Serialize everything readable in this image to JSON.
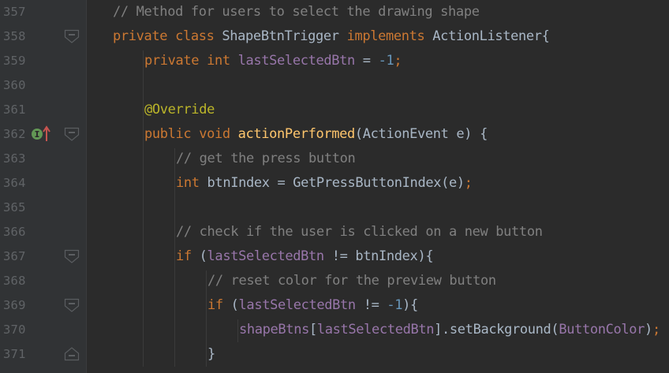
{
  "editor": {
    "lines": [
      {
        "number": "357",
        "indent": 0,
        "tokens": [
          [
            "c-comment",
            "// Method for users to select the drawing shape"
          ]
        ]
      },
      {
        "number": "358",
        "indent": 0,
        "fold": "open",
        "tokens": [
          [
            "c-kw",
            "private class "
          ],
          [
            "c-plain",
            "ShapeBtnTrigger "
          ],
          [
            "c-kw",
            "implements "
          ],
          [
            "c-plain",
            "ActionListener{"
          ]
        ]
      },
      {
        "number": "359",
        "indent": 1,
        "tokens": [
          [
            "c-kw",
            "private int "
          ],
          [
            "c-field",
            "lastSelectedBtn"
          ],
          [
            "c-plain",
            " = "
          ],
          [
            "c-num",
            "-1"
          ],
          [
            "c-kw",
            ";"
          ]
        ]
      },
      {
        "number": "360",
        "indent": 1,
        "tokens": []
      },
      {
        "number": "361",
        "indent": 1,
        "tokens": [
          [
            "c-ann",
            "@Override"
          ]
        ]
      },
      {
        "number": "362",
        "indent": 1,
        "fold": "open",
        "marker": "implements-method",
        "tokens": [
          [
            "c-kw",
            "public void "
          ],
          [
            "c-method",
            "actionPerformed"
          ],
          [
            "c-plain",
            "(ActionEvent e) {"
          ]
        ]
      },
      {
        "number": "363",
        "indent": 2,
        "tokens": [
          [
            "c-comment",
            "// get the press button"
          ]
        ]
      },
      {
        "number": "364",
        "indent": 2,
        "tokens": [
          [
            "c-kw",
            "int "
          ],
          [
            "c-plain",
            "btnIndex = GetPressButtonIndex(e)"
          ],
          [
            "c-kw",
            ";"
          ]
        ]
      },
      {
        "number": "365",
        "indent": 2,
        "tokens": []
      },
      {
        "number": "366",
        "indent": 2,
        "tokens": [
          [
            "c-comment",
            "// check if the user is clicked on a new button"
          ]
        ]
      },
      {
        "number": "367",
        "indent": 2,
        "fold": "open",
        "tokens": [
          [
            "c-kw",
            "if "
          ],
          [
            "c-plain",
            "("
          ],
          [
            "c-field",
            "lastSelectedBtn"
          ],
          [
            "c-plain",
            " != btnIndex){"
          ]
        ]
      },
      {
        "number": "368",
        "indent": 3,
        "tokens": [
          [
            "c-comment",
            "// reset color for the preview button"
          ]
        ]
      },
      {
        "number": "369",
        "indent": 3,
        "fold": "open",
        "tokens": [
          [
            "c-kw",
            "if "
          ],
          [
            "c-plain",
            "("
          ],
          [
            "c-field",
            "lastSelectedBtn"
          ],
          [
            "c-plain",
            " != "
          ],
          [
            "c-num",
            "-1"
          ],
          [
            "c-plain",
            "){"
          ]
        ]
      },
      {
        "number": "370",
        "indent": 4,
        "tokens": [
          [
            "c-field",
            "shapeBtns"
          ],
          [
            "c-plain",
            "["
          ],
          [
            "c-field",
            "lastSelectedBtn"
          ],
          [
            "c-plain",
            "].setBackground("
          ],
          [
            "c-field",
            "ButtonColor"
          ],
          [
            "c-plain",
            ")"
          ],
          [
            "c-kw",
            ";"
          ]
        ]
      },
      {
        "number": "371",
        "indent": 3,
        "fold": "close",
        "tokens": [
          [
            "c-plain",
            "}"
          ]
        ]
      }
    ]
  },
  "colors": {
    "background": "#2b2b2b",
    "gutter": "#313335",
    "line_number": "#606366",
    "comment": "#808080",
    "keyword": "#cc7832",
    "plain": "#a9b7c6",
    "field": "#9876aa",
    "number": "#6897bb",
    "annotation": "#bbb529",
    "method_declaration": "#ffc66d",
    "implements_marker": "#629755",
    "implements_arrow": "#c75450"
  },
  "icons": {
    "fold_open": "fold-open-icon",
    "fold_close": "fold-close-icon",
    "implements_method": "implements-method-icon"
  }
}
